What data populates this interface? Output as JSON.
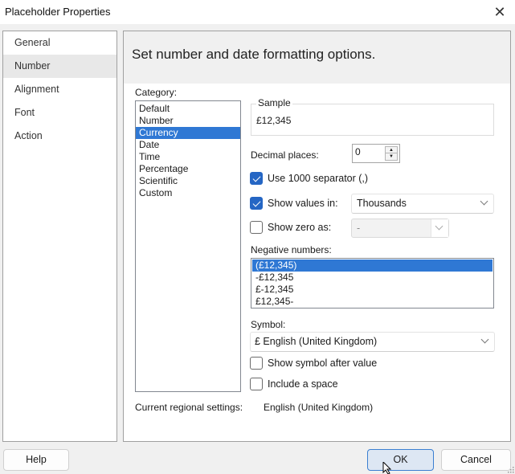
{
  "window": {
    "title": "Placeholder Properties",
    "close_icon": "close-icon"
  },
  "nav": {
    "items": [
      {
        "label": "General",
        "active": false
      },
      {
        "label": "Number",
        "active": true
      },
      {
        "label": "Alignment",
        "active": false
      },
      {
        "label": "Font",
        "active": false
      },
      {
        "label": "Action",
        "active": false
      }
    ]
  },
  "main": {
    "header": "Set number and date formatting options.",
    "category": {
      "label": "Category:",
      "items": [
        "Default",
        "Number",
        "Currency",
        "Date",
        "Time",
        "Percentage",
        "Scientific",
        "Custom"
      ],
      "selected": "Currency"
    },
    "sample": {
      "label": "Sample",
      "value": "£12,345"
    },
    "decimal_places": {
      "label": "Decimal places:",
      "value": "0"
    },
    "use_separator": {
      "label": "Use 1000 separator (,)",
      "checked": true
    },
    "show_values_in": {
      "label": "Show values in:",
      "checked": true,
      "value": "Thousands"
    },
    "show_zero_as": {
      "label": "Show zero as:",
      "checked": false,
      "value": "-"
    },
    "negative_numbers": {
      "label": "Negative numbers:",
      "items": [
        "(£12,345)",
        "-£12,345",
        "£-12,345",
        "£12,345-"
      ],
      "selected": "(£12,345)"
    },
    "symbol": {
      "label": "Symbol:",
      "value": "£ English (United Kingdom)"
    },
    "show_symbol_after": {
      "label": "Show symbol after value",
      "checked": false
    },
    "include_space": {
      "label": "Include a space",
      "checked": false
    },
    "regional": {
      "label": "Current regional settings:",
      "value": "English (United Kingdom)"
    }
  },
  "buttons": {
    "help": "Help",
    "ok": "OK",
    "cancel": "Cancel"
  },
  "colors": {
    "selection": "#2f78d4",
    "checkbox_checked": "#2566c4",
    "default_button_border": "#3b7fd1"
  }
}
